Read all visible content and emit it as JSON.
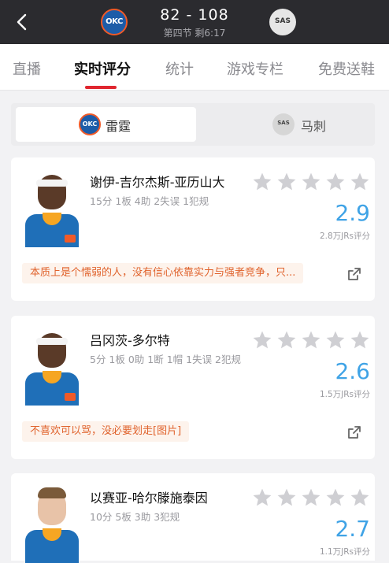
{
  "header": {
    "score": "82 - 108",
    "period": "第四节 剩6:17",
    "home_logo_text": "OKC",
    "away_logo_text": "SAS"
  },
  "tabs": [
    "直播",
    "实时评分",
    "统计",
    "游戏专栏",
    "免费送鞋"
  ],
  "active_tab": "实时评分",
  "team_toggle": {
    "home": {
      "label": "雷霆",
      "logo_text": "OKC"
    },
    "away": {
      "label": "马刺",
      "logo_text": "SAS"
    }
  },
  "colors": {
    "accent": "#e0262f",
    "rating": "#3fa3e6",
    "comment": "#e0632d",
    "star_empty": "#cfcfd3"
  },
  "players": [
    {
      "name": "谢伊-吉尔杰斯-亚历山大",
      "stats": "15分 1板 4助 2失误 1犯规",
      "rating": "2.9",
      "votes": "2.8万JRs评分",
      "comment": "本质上是个懦弱的人，没有信心依靠实力与强者竞争，只...",
      "stars_filled": 0
    },
    {
      "name": "吕冈茨-多尔特",
      "stats": "5分 1板 0助 1断 1帽 1失误 2犯规",
      "rating": "2.6",
      "votes": "1.5万JRs评分",
      "comment": "不喜欢可以骂，没必要划走[图片]",
      "stars_filled": 0
    },
    {
      "name": "以赛亚-哈尔滕施泰因",
      "stats": "10分 5板 3助 3犯规",
      "rating": "2.7",
      "votes": "1.1万JRs评分",
      "comment": "",
      "stars_filled": 0
    }
  ]
}
